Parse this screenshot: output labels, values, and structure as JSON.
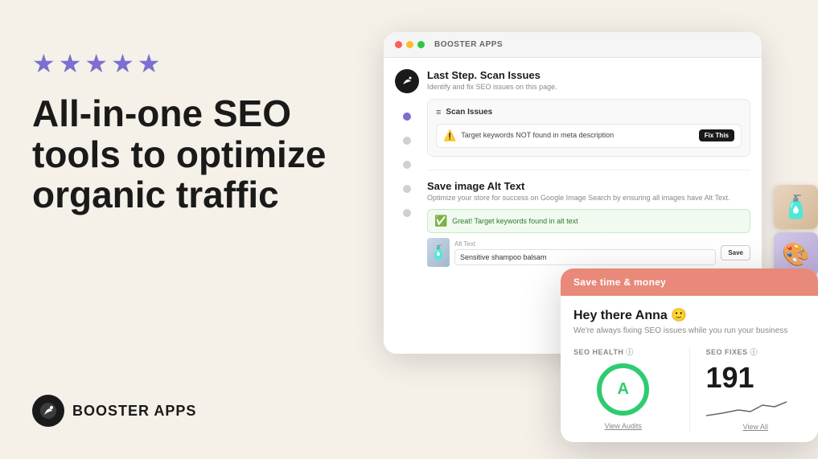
{
  "page": {
    "background": "#f5f0e8"
  },
  "left": {
    "stars": [
      "★",
      "★",
      "★",
      "★",
      "★"
    ],
    "headline_line1": "All-in-one SEO",
    "headline_line2": "tools to optimize",
    "headline_line3": "organic traffic",
    "logo_text": "BOOSTER APPS"
  },
  "tablet": {
    "window_label": "BOOSTER APPS",
    "step1": {
      "title": "Last Step. Scan Issues",
      "description": "Identify and fix SEO issues on this page.",
      "panel_label": "Scan Issues",
      "issue_text": "Target keywords NOT found in meta description",
      "fix_button": "Fix This"
    },
    "step2": {
      "title": "Save image Alt Text",
      "description": "Optimize your store for success on Google Image Search by ensuring all images have Alt Text.",
      "success_text": "Great! Target keywords found in alt text",
      "field_label": "Alt Text",
      "field_value": "Sensitive shampoo balsam",
      "save_button": "Save"
    }
  },
  "front_card": {
    "header": "Save time & money",
    "greeting": "Hey there Anna 🙂",
    "subtitle": "We're always fixing SEO issues while you run your business",
    "seo_health": {
      "label": "SEO HEALTH",
      "grade": "A",
      "view_link": "View Audits"
    },
    "seo_fixes": {
      "label": "SEO FIXES",
      "number": "191",
      "view_link": "View All"
    }
  }
}
